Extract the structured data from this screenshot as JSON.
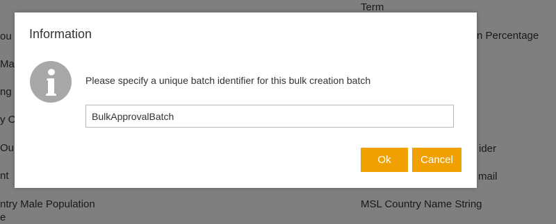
{
  "background": {
    "texts": [
      {
        "id": "bg-term",
        "text": "Term"
      },
      {
        "id": "bg-percentage",
        "text": "n Percentage"
      },
      {
        "id": "bg-ider",
        "text": "ider"
      },
      {
        "id": "bg-mail",
        "text": "mail"
      },
      {
        "id": "bg-male-pop",
        "text": "ntry Male Population"
      },
      {
        "id": "bg-msl",
        "text": "MSL Country Name String"
      },
      {
        "id": "bg-frag1",
        "text": "ou"
      },
      {
        "id": "bg-frag2",
        "text": "Ma"
      },
      {
        "id": "bg-frag3",
        "text": "ng"
      },
      {
        "id": "bg-frag4",
        "text": "y O"
      },
      {
        "id": "bg-frag5",
        "text": "Ou"
      },
      {
        "id": "bg-frag6",
        "text": "nt"
      },
      {
        "id": "bg-frag7",
        "text": "e"
      }
    ]
  },
  "dialog": {
    "title": "Information",
    "icon": "info-icon",
    "message": "Please specify a unique batch identifier for this bulk creation batch",
    "input_value": "BulkApprovalBatch",
    "ok_label": "Ok",
    "cancel_label": "Cancel"
  },
  "colors": {
    "accent": "#f0a000",
    "icon_gray": "#a8a8a8",
    "overlay": "rgba(0,0,0,0.5)"
  }
}
